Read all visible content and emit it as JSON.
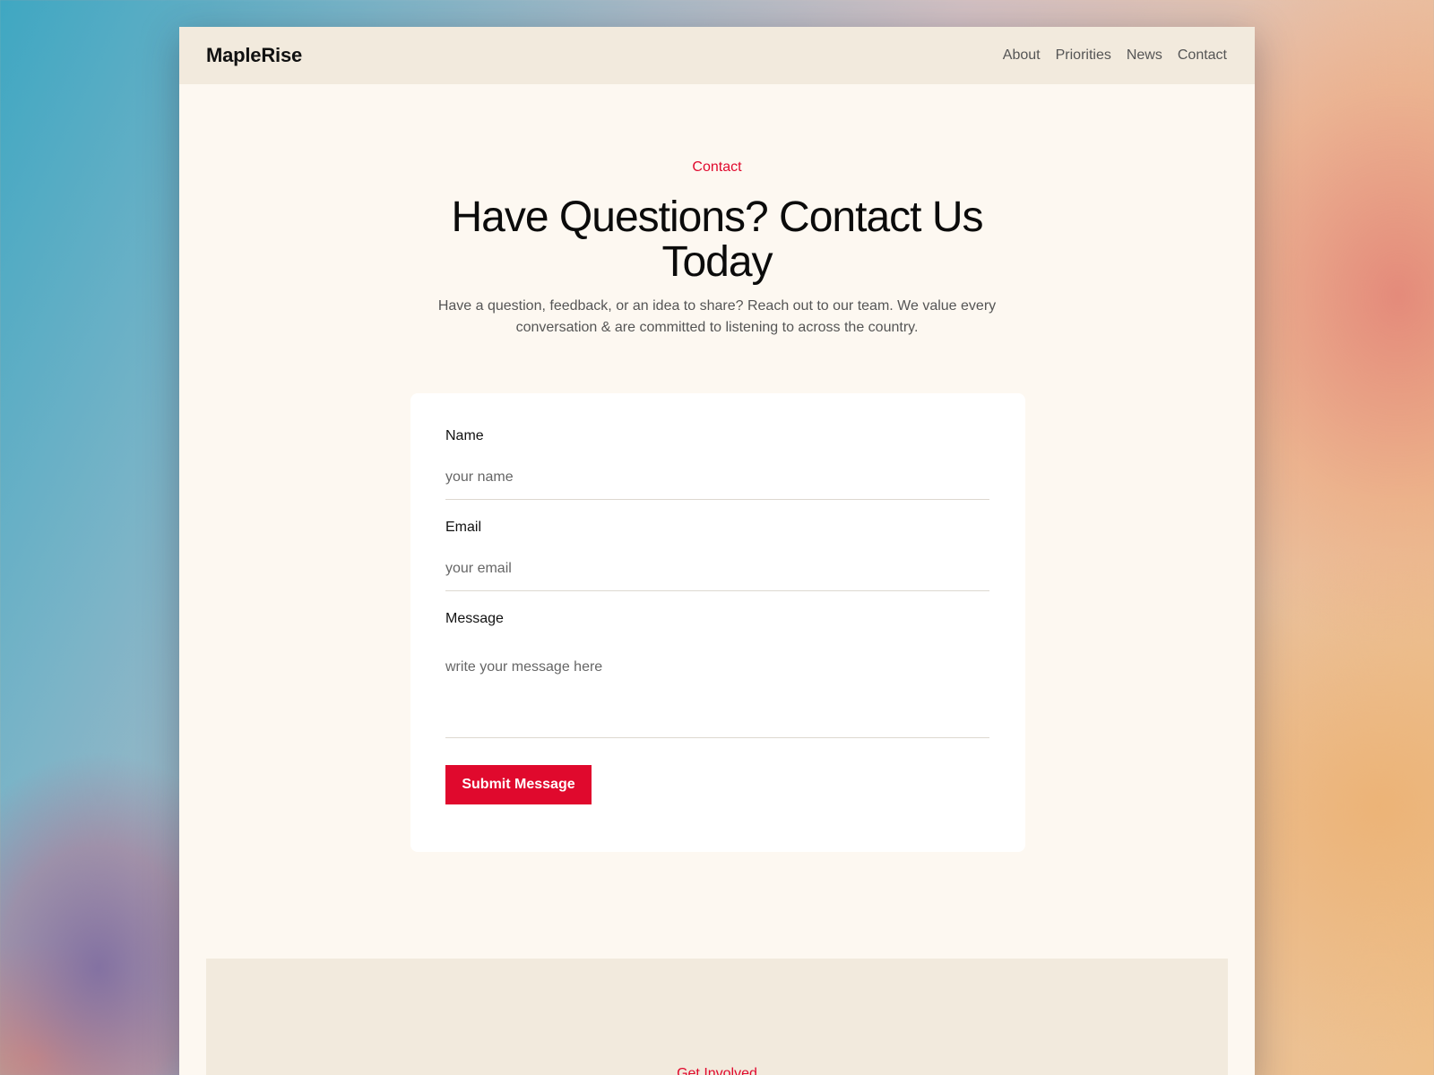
{
  "nav": {
    "brand": "MapleRise",
    "links": [
      "About",
      "Priorities",
      "News",
      "Contact"
    ]
  },
  "hero": {
    "eyebrow": "Contact",
    "heading": "Have Questions? Contact Us Today",
    "subtext": "Have a question, feedback, or an idea to share? Reach out to our team. We value every conversation & are committed to listening to across the country."
  },
  "form": {
    "name_label": "Name",
    "name_placeholder": "your name",
    "email_label": "Email",
    "email_placeholder": "your email",
    "message_label": "Message",
    "message_placeholder": "write your message here",
    "submit_label": "Submit Message"
  },
  "involved": {
    "eyebrow": "Get Involved"
  },
  "colors": {
    "accent": "#e0092d",
    "nav_bg": "#f2eadd",
    "page_bg": "#fdf8f1"
  }
}
